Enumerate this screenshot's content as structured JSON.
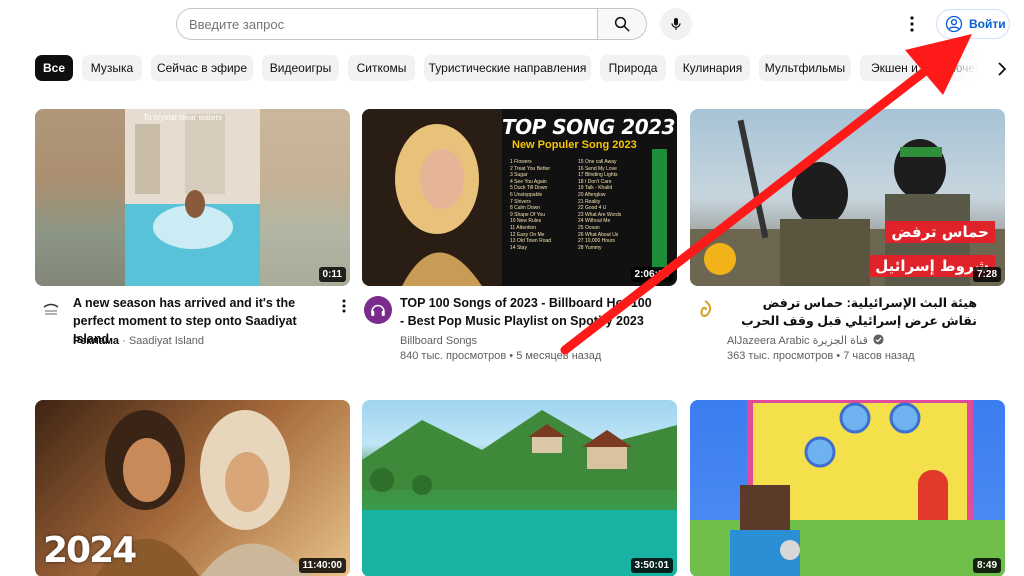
{
  "header": {
    "search_placeholder": "Введите запрос",
    "signin_label": "Войти"
  },
  "chips": [
    {
      "label": "Все",
      "active": true
    },
    {
      "label": "Музыка"
    },
    {
      "label": "Сейчас в эфире"
    },
    {
      "label": "Видеоигры"
    },
    {
      "label": "Ситкомы"
    },
    {
      "label": "Туристические направления"
    },
    {
      "label": "Природа"
    },
    {
      "label": "Кулинария"
    },
    {
      "label": "Мультфильмы"
    },
    {
      "label": "Экшен и приключения"
    }
  ],
  "videos": [
    {
      "title": "A new season has arrived and it's the perfect moment to step onto Saadiyat Island",
      "channel": "Saadiyat Island",
      "ad_label": "Реклама",
      "duration": "0:11",
      "thumb_caption": "To crystal clear waters",
      "avatar_icon": "saadiyat-logo-icon"
    },
    {
      "title": "TOP 100 Songs of 2023 - Billboard Hot 100 - Best Pop Music Playlist on Spotify 2023",
      "channel": "Billboard Songs",
      "views": "840 тыс. просмотров",
      "age": "5 месяцев назад",
      "duration": "2:06:16",
      "thumb_title": "TOP SONG 2023",
      "thumb_subtitle": "New Populer Song 2023",
      "thumb_songs": [
        "Flowers",
        "Treat You Better",
        "Sugar",
        "See You Again",
        "Duck Till Down",
        "Unstoppable",
        "Shivers",
        "Calm Down",
        "Shape Of You",
        "New Rules",
        "Attention",
        "Easy On Me",
        "Old Town Road",
        "Stay",
        "One call Away",
        "Send My Love",
        "Blinding Lights",
        "I Don't Care",
        "Talk - Khalid",
        "Afterglow",
        "Reality",
        "Good 4 U",
        "What Are Words",
        "Without Me",
        "Ocean",
        "What About Us",
        "10,000 Hours",
        "Yummy"
      ],
      "avatar_icon": "headphones-icon"
    },
    {
      "title": "هيئة البث الإسرائيلية: حماس ترفض نقاش عرض إسرائيلي قبل وقف الحرب",
      "channel": "AlJazeera Arabic قناة الجزيرة",
      "views": "363 тыс. просмотров",
      "age": "7 часов назад",
      "duration": "7:28",
      "thumb_line1": "حماس ترفض",
      "thumb_line2": "شروط إسرائيل",
      "avatar_icon": "aljazeera-logo-icon",
      "verified_icon": "verified-check-icon"
    },
    {
      "duration": "11:40:00",
      "thumb_text": "2024"
    },
    {
      "duration": "3:50:01"
    },
    {
      "duration": "8:49"
    }
  ],
  "colors": {
    "accent_blue": "#065fd4",
    "chip_active": "#0f0f0f",
    "chip_bg": "#f2f2f2",
    "annotation_arrow": "#ff1a1a"
  }
}
